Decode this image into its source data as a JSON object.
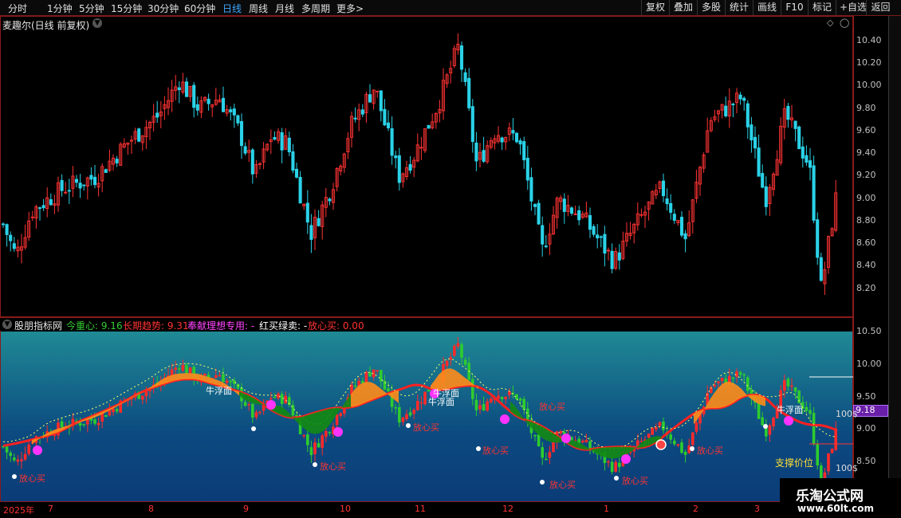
{
  "toolbar": {
    "periods": [
      "分时",
      "1分钟",
      "5分钟",
      "15分钟",
      "30分钟",
      "60分钟",
      "日线",
      "周线",
      "月线",
      "多周期",
      "更多"
    ],
    "active_period": "日线",
    "more_arrow": ">",
    "tools": [
      "复权",
      "叠加",
      "多股",
      "统计",
      "画线",
      "F10",
      "标记",
      "+自选",
      "返回"
    ]
  },
  "main_chart": {
    "title": "麦趣尔(日线 前复权)",
    "collapse_icon": "chevron-down-icon",
    "diamond_icon": "◇",
    "right_icon": "◯",
    "y_ticks": [
      "10.40",
      "10.20",
      "10.00",
      "9.80",
      "9.60",
      "9.40",
      "9.20",
      "9.00",
      "8.80",
      "8.60",
      "8.40",
      "8.20"
    ]
  },
  "indicator": {
    "name": "股朋指标网",
    "items": [
      {
        "label": "今重心: 9.16",
        "color": "#33cc33"
      },
      {
        "label": "长期趋势: 9.31",
        "color": "#ff3333"
      },
      {
        "label": "奉献理想专用: -",
        "color": "#ff44ff"
      },
      {
        "label": "红买绿卖: -",
        "color": "#ffffff"
      },
      {
        "label": "放心买: 0.00",
        "color": "#ff3333"
      }
    ],
    "y_ticks": [
      "10.50",
      "10.00",
      "9.50",
      "9.00",
      "8.50"
    ],
    "price_tag": "9.18",
    "support_label": "支撑价位",
    "side_numbers": [
      "100$",
      "100$"
    ],
    "annotations": {
      "float": "牛浮面",
      "buy": "放心买"
    }
  },
  "x_axis": [
    "2025年",
    "7",
    "8",
    "9",
    "10",
    "11",
    "12",
    "1",
    "2",
    "3"
  ],
  "watermark": {
    "line1": "乐淘公式网",
    "line2": "www.60lt.com"
  },
  "colors": {
    "up": "#ff3333",
    "down": "#2ad2e8",
    "band_up": "#ff8c1a",
    "band_down": "#138a13",
    "trend": "#ff2020"
  }
}
